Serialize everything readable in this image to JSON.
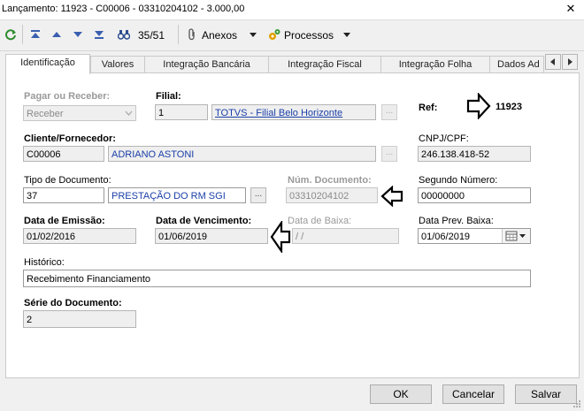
{
  "window": {
    "title": "Lançamento: 11923 - C00006 - 03310204102 - 3.000,00",
    "close_glyph": "✕"
  },
  "toolbar": {
    "record_counter": "35/51",
    "attachments_label": "Anexos",
    "processes_label": "Processos",
    "icons": [
      "refresh-icon",
      "first-record-icon",
      "previous-record-icon",
      "next-record-icon",
      "last-record-icon",
      "binoculars-icon",
      "paperclip-icon",
      "gears-icon"
    ]
  },
  "tabs": [
    {
      "label": "Identificação",
      "active": true
    },
    {
      "label": "Valores",
      "active": false
    },
    {
      "label": "Integração Bancária",
      "active": false
    },
    {
      "label": "Integração Fiscal",
      "active": false
    },
    {
      "label": "Integração Folha",
      "active": false
    },
    {
      "label": "Dados Ad",
      "active": false
    }
  ],
  "form": {
    "pagar_receber": {
      "label": "Pagar ou Receber:",
      "value": "Receber"
    },
    "filial": {
      "label": "Filial:",
      "code": "1",
      "name": "TOTVS - Filial Belo Horizonte"
    },
    "ref": {
      "label": "Ref:",
      "value": "11923"
    },
    "cliente": {
      "label": "Cliente/Fornecedor:",
      "code": "C00006",
      "name": "ADRIANO ASTONI"
    },
    "cnpj": {
      "label": "CNPJ/CPF:",
      "value": "246.138.418-52"
    },
    "tipo_documento": {
      "label": "Tipo de Documento:",
      "code": "37",
      "name": "PRESTAÇÃO DO RM SGI"
    },
    "num_documento": {
      "label": "Núm. Documento:",
      "value": "03310204102"
    },
    "segundo_numero": {
      "label": "Segundo Número:",
      "value": "00000000"
    },
    "data_emissao": {
      "label": "Data de Emissão:",
      "value": "01/02/2016"
    },
    "data_vencimento": {
      "label": "Data de Vencimento:",
      "value": "01/06/2019"
    },
    "data_baixa": {
      "label": "Data de Baixa:",
      "value": "/ /"
    },
    "data_prev_baixa": {
      "label": "Data Prev. Baixa:",
      "value": "01/06/2019"
    },
    "historico": {
      "label": "Histórico:",
      "value": "Recebimento Financiamento"
    },
    "serie": {
      "label": "Série do Documento:",
      "value": "2"
    },
    "lookup_glyph": "..."
  },
  "buttons": {
    "ok": "OK",
    "cancel": "Cancelar",
    "save": "Salvar"
  },
  "colors": {
    "link": "#1a3fa8",
    "disabled_text": "#9a9a9a",
    "panel": "#ffffff",
    "chrome": "#f0f0f0"
  }
}
